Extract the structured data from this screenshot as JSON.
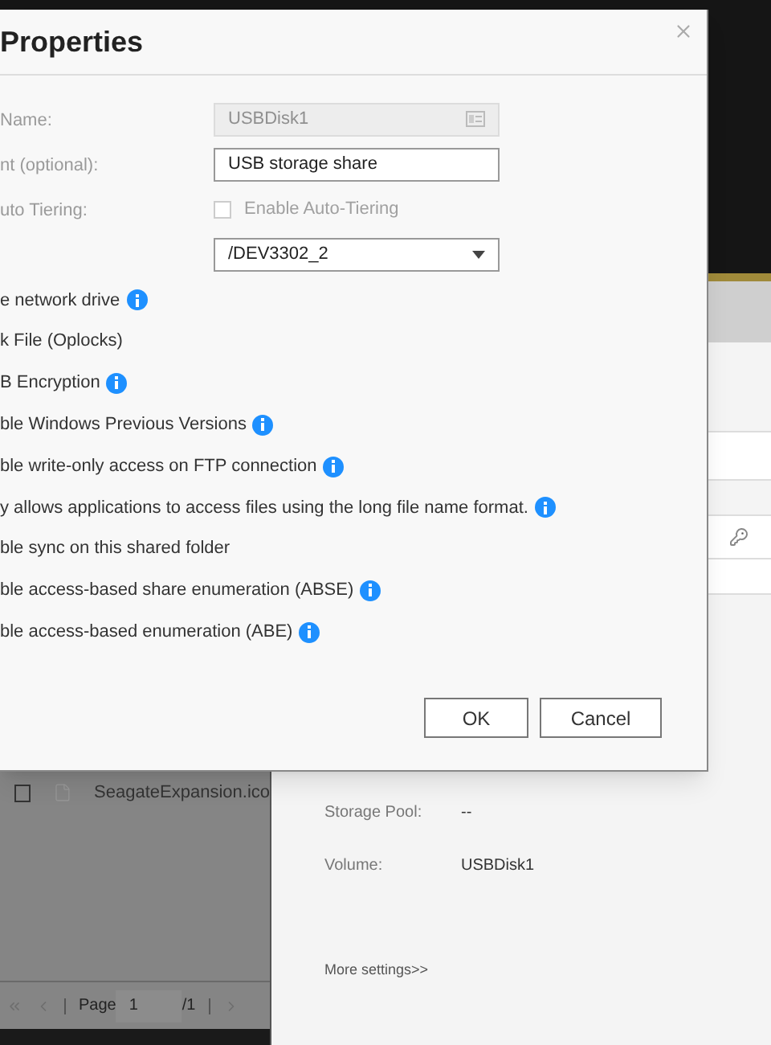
{
  "dialog": {
    "title": "Properties",
    "fields": [
      {
        "kind": "text",
        "label": "Name:",
        "value": "USBDisk1",
        "disabled": true
      },
      {
        "kind": "text",
        "label": "nt (optional):",
        "value": "USB storage share",
        "disabled": false
      },
      {
        "kind": "checkbox",
        "label": "uto Tiering:",
        "option": "Enable Auto-Tiering",
        "disabled": true,
        "checked": false
      },
      {
        "kind": "select",
        "value": "/DEV3302_2",
        "disabled": false
      }
    ],
    "options": [
      {
        "label": "e network drive",
        "info": true
      },
      {
        "label": "k File (Oplocks)",
        "info": false
      },
      {
        "label": "B Encryption",
        "info": true
      },
      {
        "label": "ble Windows Previous Versions",
        "info": true
      },
      {
        "label": "ble write-only access on FTP connection",
        "info": true
      },
      {
        "label": "y allows applications to access files using the long file name format.",
        "info": true
      },
      {
        "label": "ble sync on this shared folder",
        "info": false
      },
      {
        "label": "ble access-based share enumeration (ABSE)",
        "info": true
      },
      {
        "label": "ble access-based enumeration (ABE)",
        "info": true
      }
    ],
    "buttons": [
      "OK",
      "Cancel"
    ]
  },
  "file_list": {
    "rows": [
      {
        "name": "SeagateExpansion.ico",
        "checked": false
      }
    ],
    "pagination": {
      "label": "Page",
      "value": "1",
      "total": "/1"
    }
  },
  "details": {
    "rows": [
      {
        "label": "Storage Pool:",
        "value": "--"
      },
      {
        "label": "Volume:",
        "value": "USBDisk1"
      }
    ],
    "link": "More settings>>"
  }
}
